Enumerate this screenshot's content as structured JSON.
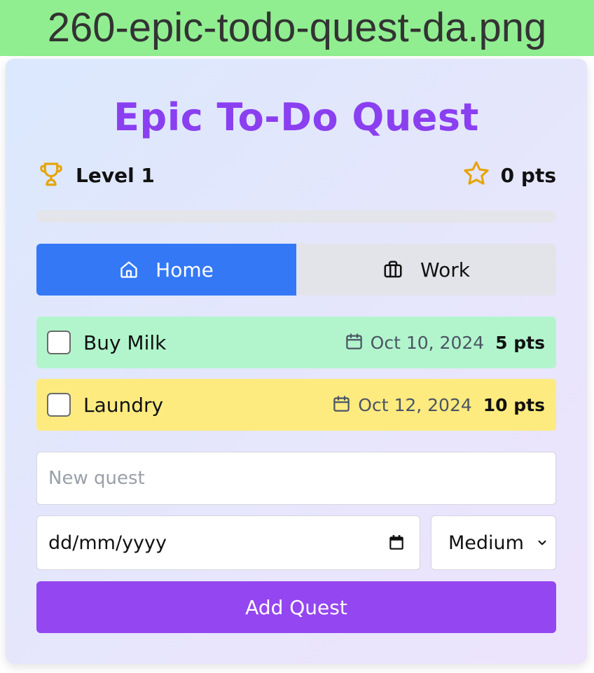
{
  "file_banner": {
    "label": "260-epic-todo-quest-da.png"
  },
  "app": {
    "title": "Epic To-Do Quest",
    "level_label": "Level 1",
    "points_label": "0 pts",
    "progress_fraction": 0
  },
  "tabs": [
    {
      "label": "Home",
      "icon": "home-icon",
      "active": true
    },
    {
      "label": "Work",
      "icon": "briefcase-icon",
      "active": false
    }
  ],
  "quests": [
    {
      "name": "Buy Milk",
      "date": "Oct 10, 2024",
      "points": "5 pts",
      "checked": false,
      "color": "#b2f5cd"
    },
    {
      "name": "Laundry",
      "date": "Oct 12, 2024",
      "points": "10 pts",
      "checked": false,
      "color": "#feeb80"
    }
  ],
  "form": {
    "new_quest_placeholder": "New quest",
    "new_quest_value": "",
    "date_placeholder": "dd/mm/yyyy",
    "priority_selected": "Medium",
    "add_button_label": "Add Quest"
  },
  "colors": {
    "accent_purple": "#8a3ff0",
    "button_purple": "#9446f0",
    "active_tab_blue": "#3478f6",
    "trophy_gold": "#e5a50a"
  }
}
